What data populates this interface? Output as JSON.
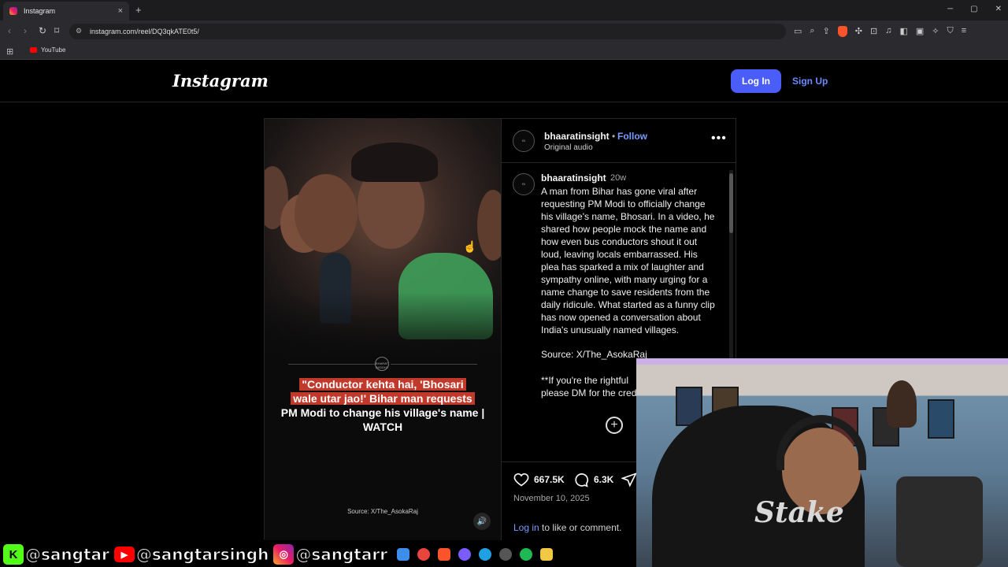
{
  "browser": {
    "tab_title": "Instagram",
    "url": "instagram.com/reel/DQ3qkATE0t5/",
    "bookmark": "YouTube"
  },
  "header": {
    "logo": "Instagram",
    "login": "Log In",
    "signup": "Sign Up"
  },
  "video": {
    "logo_text": "BHARAT INSIGHT",
    "headline_highlight_1": "\"Conductor kehta hai, 'Bhosari",
    "headline_highlight_2": "wale utar jao!' Bihar man requests",
    "headline_rest": "PM Modi to change his village's name | WATCH",
    "source": "Source: X/The_AsokaRaj"
  },
  "post": {
    "username": "bhaaratinsight",
    "follow": "Follow",
    "audio": "Original audio",
    "caption_user": "bhaaratinsight",
    "caption_time": "20w",
    "caption": "A man from Bihar has gone viral after requesting PM Modi to officially change his village's name, Bhosari. In a video, he shared how people mock the name and how even bus conductors shout it out loud, leaving locals embarrassed. His plea has sparked a mix of laughter and sympathy online, with many urging for a name change to save residents from the daily ridicule. What started as a funny clip has now opened a conversation about India's unusually named villages.",
    "caption_source": "Source: X/The_AsokaRaj",
    "caption_note_1": "**If you're the rightful",
    "caption_note_2": "please DM for the cred",
    "likes": "667.5K",
    "comments": "6.3K",
    "date": "November 10, 2025",
    "login_link": "Log in",
    "login_rest": " to like or comment."
  },
  "overlay": {
    "handle_1": "@sangtar",
    "handle_2": "@sangtarsingh",
    "handle_3": "@sangtarr",
    "badge_k": "K",
    "webcam_shirt": "Stake"
  },
  "colors": {
    "login_button": "#4a5df9",
    "link": "#7a9bff",
    "headline_highlight": "#c0392b"
  }
}
